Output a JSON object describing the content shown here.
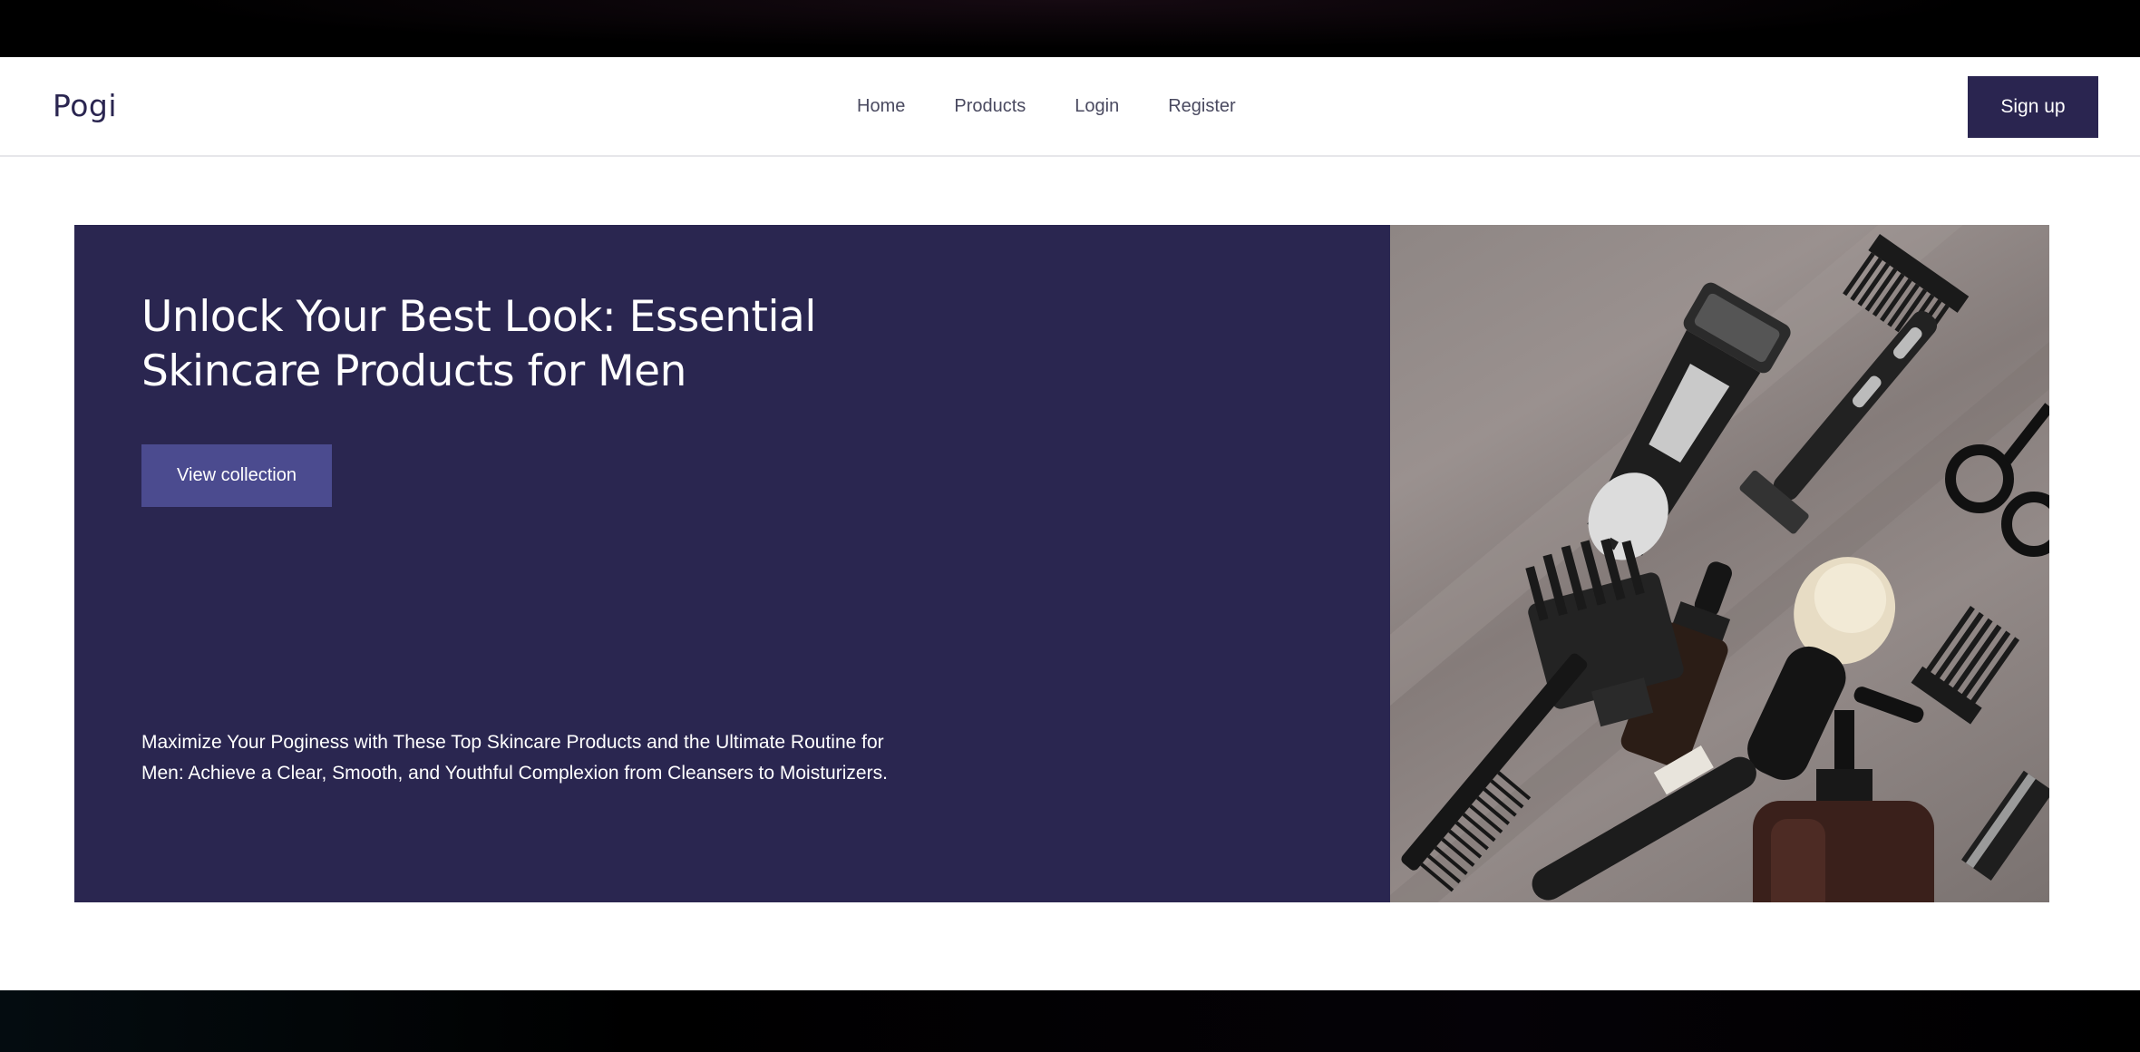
{
  "header": {
    "logo": "Pogi",
    "nav": [
      "Home",
      "Products",
      "Login",
      "Register"
    ],
    "signup_label": "Sign up"
  },
  "hero": {
    "title": "Unlock Your Best Look: Essential Skincare Products for Men",
    "cta_label": "View collection",
    "description": "Maximize Your Poginess with These Top Skincare Products and the Ultimate Routine for Men: Achieve a Clear, Smooth, and Youthful Complexion from Cleansers to Moisturizers.",
    "image": "men-grooming-tools-photo"
  },
  "colors": {
    "brand": "#2a2550",
    "hero_bg": "#2a2650",
    "cta_bg": "#4b4b8f"
  }
}
